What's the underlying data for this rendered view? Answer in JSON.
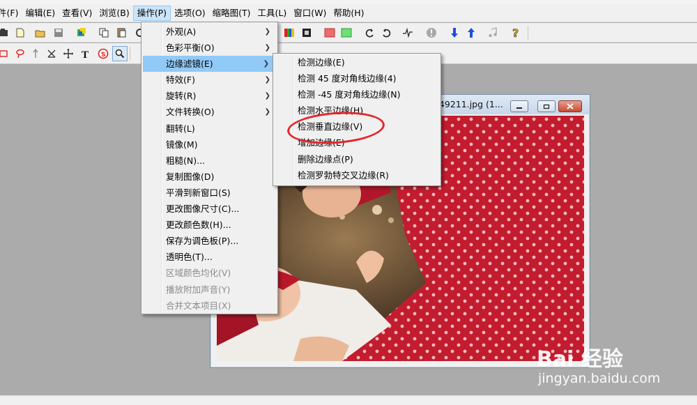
{
  "window": {
    "title": "",
    "image_window_title": "249211.jpg (1..."
  },
  "menubar": [
    {
      "label": "件(F)"
    },
    {
      "label": "编辑(E)"
    },
    {
      "label": "查看(V)"
    },
    {
      "label": "浏览(B)"
    },
    {
      "label": "操作(P)",
      "active": true
    },
    {
      "label": "选项(O)"
    },
    {
      "label": "缩略图(T)"
    },
    {
      "label": "工具(L)"
    },
    {
      "label": "窗口(W)"
    },
    {
      "label": "帮助(H)"
    }
  ],
  "operation_menu": {
    "items": [
      {
        "label": "外观(A)",
        "submenu": true
      },
      {
        "label": "色彩平衡(O)",
        "submenu": true
      },
      {
        "label": "边缘滤镜(E)",
        "submenu": true,
        "highlighted": true
      },
      {
        "label": "特效(F)",
        "submenu": true
      },
      {
        "label": "旋转(R)",
        "submenu": true
      },
      {
        "label": "文件转换(O)",
        "submenu": true
      },
      {
        "label": "翻转(L)"
      },
      {
        "label": "镜像(M)"
      },
      {
        "label": "粗糙(N)..."
      },
      {
        "label": "复制图像(D)"
      },
      {
        "label": "平滑到新窗口(S)"
      },
      {
        "label": "更改图像尺寸(C)..."
      },
      {
        "label": "更改颜色数(H)..."
      },
      {
        "label": "保存为调色板(P)..."
      },
      {
        "label": "透明色(T)..."
      },
      {
        "label": "区域颜色均化(V)",
        "disabled": true
      },
      {
        "label": "播放附加声音(Y)",
        "disabled": true
      },
      {
        "label": "合并文本项目(X)",
        "disabled": true
      }
    ]
  },
  "edge_filter_submenu": {
    "items": [
      {
        "label": "检测边缘(E)"
      },
      {
        "label": "检测 45 度对角线边缘(4)"
      },
      {
        "label": "检测 -45 度对角线边缘(N)"
      },
      {
        "label": "检测水平边缘(H)"
      },
      {
        "label": "检测垂直边缘(V)",
        "circled": true
      },
      {
        "label": "增加边缘(E)"
      },
      {
        "label": "删除边缘点(P)"
      },
      {
        "label": "检测罗勃特交叉边缘(R)"
      }
    ]
  },
  "annotation_color": "#e3262b",
  "menu_highlight_color": "#91c9f7",
  "watermark": {
    "logo": "Bai 经验",
    "url": "jingyan.baidu.com"
  }
}
